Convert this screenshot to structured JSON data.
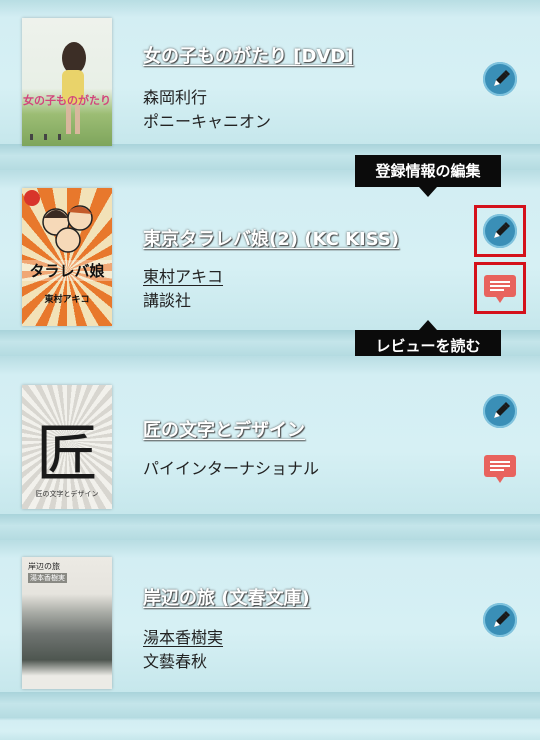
{
  "items": [
    {
      "title": "女の子ものがたり [DVD]",
      "line1": "森岡利行",
      "line2": "ポニーキャニオン",
      "cover_text": "女の子ものがたり"
    },
    {
      "title": "東京タラレバ娘(2) (KC KISS)",
      "line1": "東村アキコ",
      "line2": "講談社",
      "cover_text": "タラレバ娘",
      "cover_author": "東村アキコ"
    },
    {
      "title": "匠の文字とデザイン",
      "line1": "パイインターナショナル",
      "cover_text": "匠"
    },
    {
      "title": "岸辺の旅 (文春文庫)",
      "line1": "湯本香樹実",
      "line2": "文藝春秋",
      "cover_text": "岸辺の旅"
    }
  ],
  "tooltips": {
    "edit": "登録情報の編集",
    "review": "レビューを読む"
  },
  "icons": {
    "edit": "pencil-icon",
    "review": "speech-bubble-icon"
  },
  "colors": {
    "edit_button": "#3a8fb7",
    "review_button": "#e8635e",
    "highlight": "#d4111b"
  }
}
